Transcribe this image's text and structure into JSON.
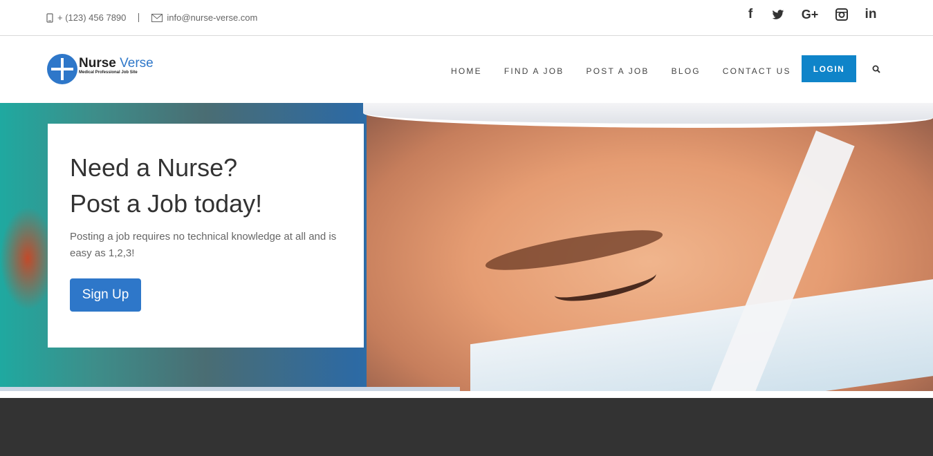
{
  "topbar": {
    "phone": "+ (123) 456 7890",
    "email": "info@nurse-verse.com",
    "social": [
      {
        "icon": "facebook-icon",
        "glyph": "f"
      },
      {
        "icon": "twitter-icon",
        "glyph": "t"
      },
      {
        "icon": "google-plus-icon",
        "glyph": "G+"
      },
      {
        "icon": "instagram-icon",
        "glyph": "◙"
      },
      {
        "icon": "linkedin-icon",
        "glyph": "in"
      }
    ]
  },
  "nav": {
    "logo": {
      "brand_a": "Nurse ",
      "brand_b": "Verse",
      "tagline": "Medical Professional Job Site"
    },
    "items": [
      "HOME",
      "FIND A JOB",
      "POST A JOB",
      "BLOG",
      "CONTACT US"
    ],
    "login_label": "LOGIN"
  },
  "hero": {
    "headline_1": "Need a Nurse?",
    "headline_2": "Post a Job today!",
    "description": "Posting a job requires no technical knowledge at all and is easy as 1,2,3!",
    "cta_label": "Sign Up"
  },
  "colors": {
    "primary": "#2e77c9",
    "login": "#0f84c9",
    "footer": "#333333"
  }
}
